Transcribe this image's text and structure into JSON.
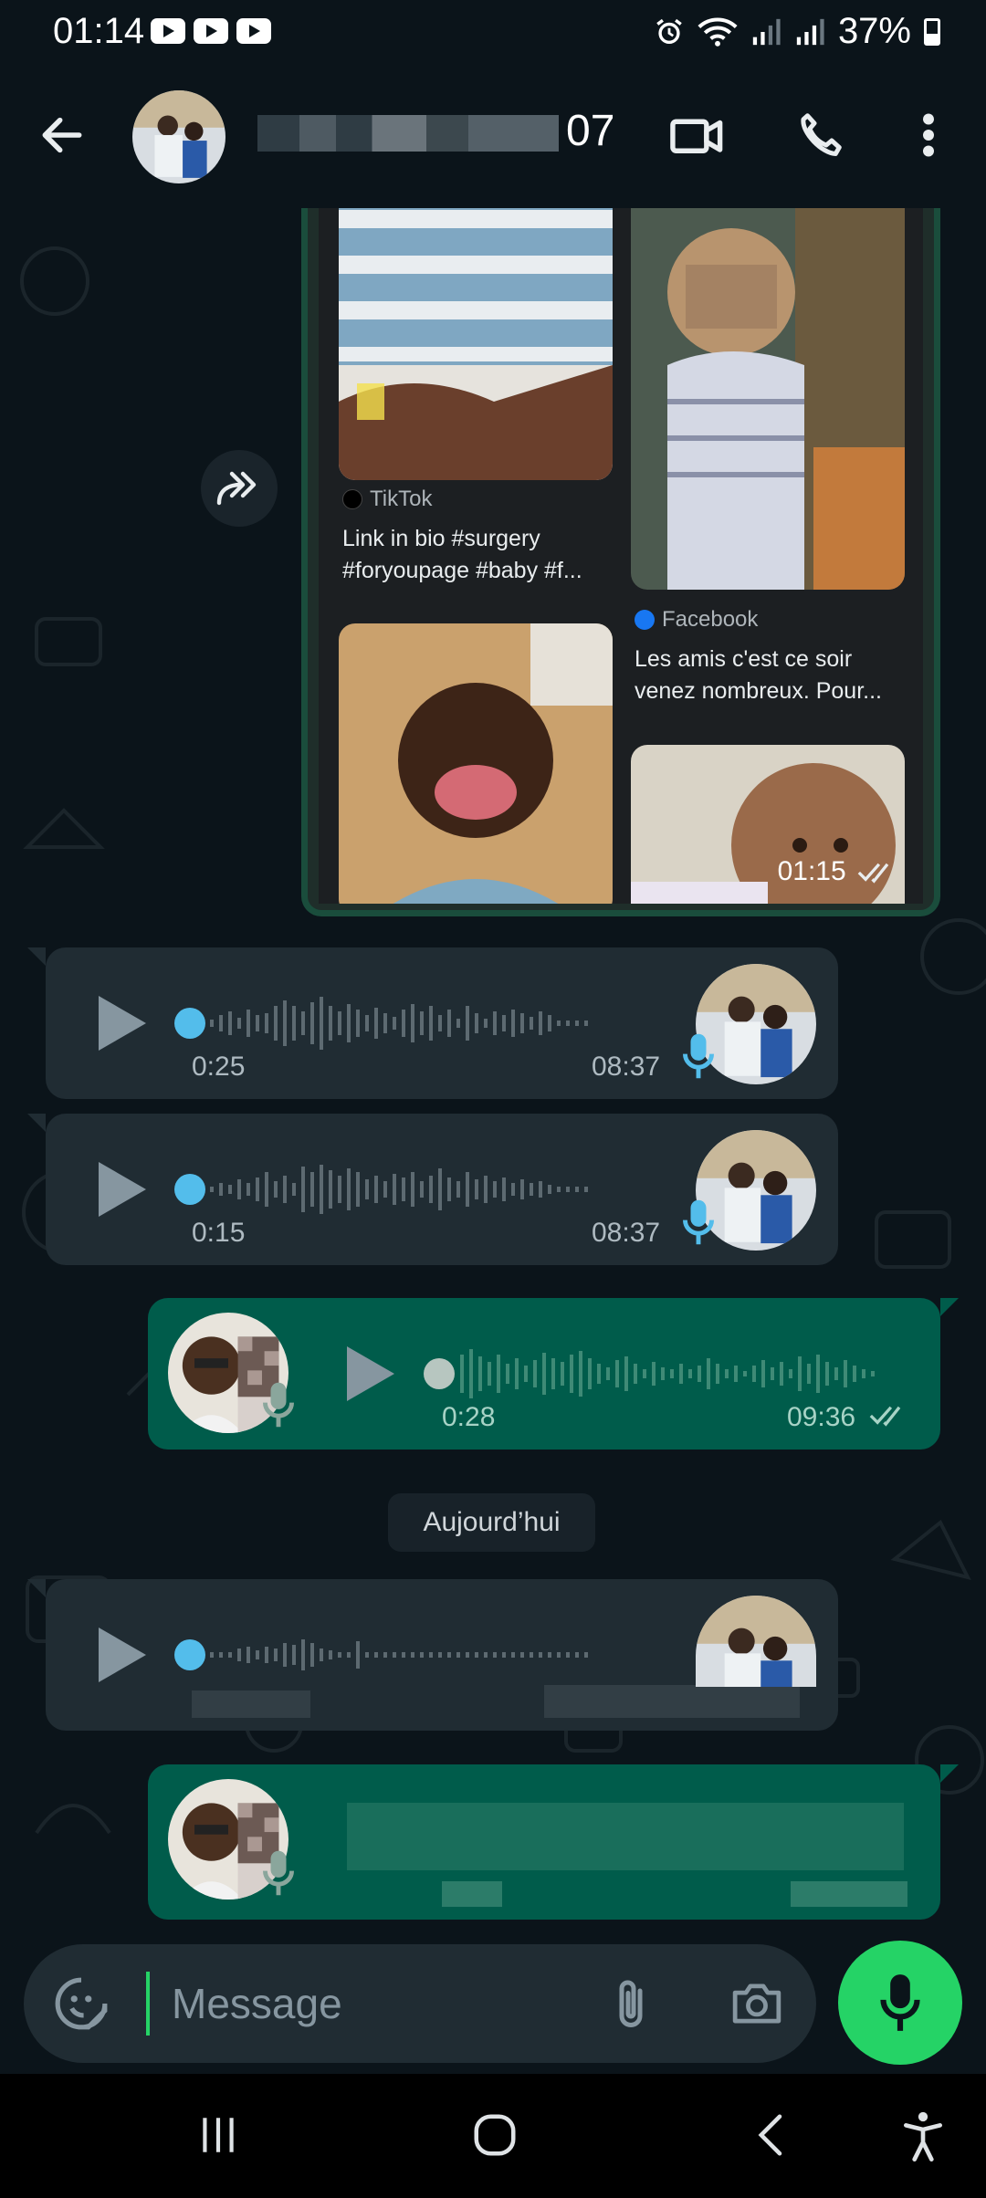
{
  "status_bar": {
    "time": "01:14",
    "notification_icons": [
      "youtube-icon",
      "youtube-icon",
      "youtube-icon"
    ],
    "status_icons": [
      "alarm-icon",
      "wifi-icon",
      "signal-icon",
      "signal-icon"
    ],
    "battery": "37%"
  },
  "header": {
    "contact_name_visible": "07",
    "actions": [
      "video-call-icon",
      "voice-call-icon",
      "more-options-icon"
    ]
  },
  "forwarded_media": {
    "items": [
      {
        "source": "TikTok",
        "caption": "Link in bio #surgery #foryoupage #baby #f..."
      },
      {
        "source": "Facebook",
        "caption": "Les amis c'est ce soir venez nombreux. Pour..."
      }
    ],
    "time": "01:15"
  },
  "voice_messages": [
    {
      "direction": "incoming",
      "duration": "0:25",
      "time": "08:37",
      "progress": 0
    },
    {
      "direction": "incoming",
      "duration": "0:15",
      "time": "08:37",
      "progress": 0
    },
    {
      "direction": "outgoing",
      "duration": "0:28",
      "time": "09:36",
      "progress": 0
    },
    {
      "direction": "incoming",
      "duration": "",
      "time": "",
      "progress": 0
    }
  ],
  "date_separator": "Aujourd’hui",
  "compose": {
    "placeholder": "Message"
  },
  "colors": {
    "app_background": "#0b141a",
    "incoming_bubble": "#202c33",
    "outgoing_bubble": "#005c4b",
    "accent_green": "#25d366",
    "unplayed_dot": "#53bdeb"
  }
}
